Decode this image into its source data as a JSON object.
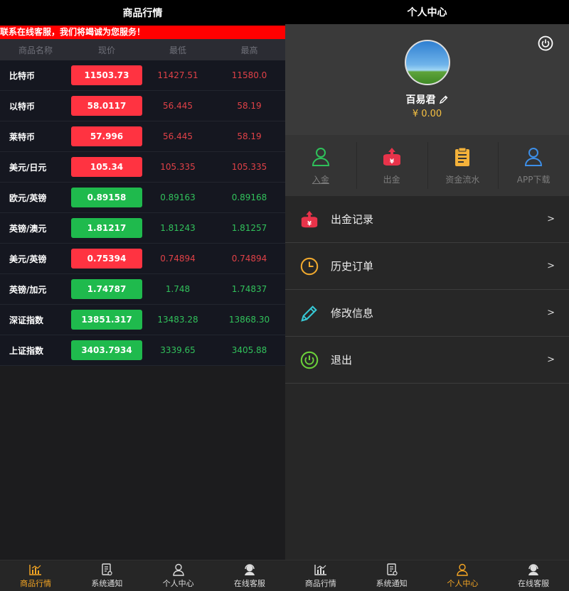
{
  "left": {
    "header_title": "商品行情",
    "marquee_text": "联系在线客服，我们将竭诚为您服务！",
    "columns": [
      "商品名称",
      "现价",
      "最低",
      "最高"
    ],
    "rows": [
      {
        "name": "比特币",
        "price": "11503.73",
        "low": "11427.51",
        "high": "11580.0",
        "trend": "down"
      },
      {
        "name": "以特币",
        "price": "58.0117",
        "low": "56.445",
        "high": "58.19",
        "trend": "down"
      },
      {
        "name": "莱特币",
        "price": "57.996",
        "low": "56.445",
        "high": "58.19",
        "trend": "down"
      },
      {
        "name": "美元/日元",
        "price": "105.34",
        "low": "105.335",
        "high": "105.335",
        "trend": "down"
      },
      {
        "name": "欧元/英镑",
        "price": "0.89158",
        "low": "0.89163",
        "high": "0.89168",
        "trend": "up"
      },
      {
        "name": "英镑/澳元",
        "price": "1.81217",
        "low": "1.81243",
        "high": "1.81257",
        "trend": "up"
      },
      {
        "name": "美元/英镑",
        "price": "0.75394",
        "low": "0.74894",
        "high": "0.74894",
        "trend": "down"
      },
      {
        "name": "英镑/加元",
        "price": "1.74787",
        "low": "1.748",
        "high": "1.74837",
        "trend": "up"
      },
      {
        "name": "深证指数",
        "price": "13851.317",
        "low": "13483.28",
        "high": "13868.30",
        "trend": "up"
      },
      {
        "name": "上证指数",
        "price": "3403.7934",
        "low": "3339.65",
        "high": "3405.88",
        "trend": "up"
      }
    ]
  },
  "right": {
    "header_title": "个人中心",
    "username": "百易君",
    "balance": "¥ 0.00",
    "actions": [
      {
        "label": "入金",
        "icon": "user-icon"
      },
      {
        "label": "出金",
        "icon": "withdraw-icon"
      },
      {
        "label": "资金流水",
        "icon": "clipboard-icon"
      },
      {
        "label": "APP下载",
        "icon": "user-icon"
      }
    ],
    "menu": [
      {
        "label": "出金记录",
        "icon": "withdraw-icon"
      },
      {
        "label": "历史订单",
        "icon": "clock-icon"
      },
      {
        "label": "修改信息",
        "icon": "pencil-icon"
      },
      {
        "label": "退出",
        "icon": "power-icon"
      }
    ],
    "arrow": ">"
  },
  "nav": {
    "items": [
      "商品行情",
      "系统通知",
      "个人中心",
      "在线客服"
    ]
  },
  "colors": {
    "accent": "#f6a623",
    "up": "#1fba4d",
    "down": "#ff3341",
    "marquee": "#ff0000"
  }
}
